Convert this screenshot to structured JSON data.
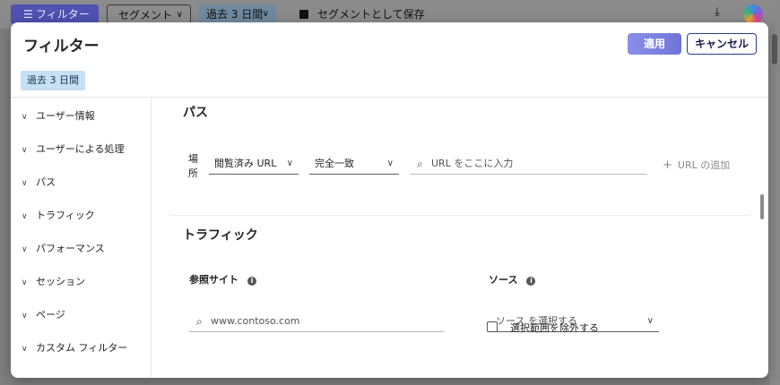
{
  "topbar": {
    "filter_label": "フィルター",
    "segment_label": "セグメント",
    "date_label": "過去 3 日間",
    "save_label": "セグメントとして保存"
  },
  "dialog": {
    "title": "フィルター",
    "apply_label": "適用",
    "cancel_label": "キャンセル",
    "date_chip": "過去 3 日間"
  },
  "sidebar": {
    "items": [
      {
        "label": "ユーザー情報"
      },
      {
        "label": "ユーザーによる処理"
      },
      {
        "label": "パス"
      },
      {
        "label": "トラフィック"
      },
      {
        "label": "パフォーマンス"
      },
      {
        "label": "セッション"
      },
      {
        "label": "ページ"
      },
      {
        "label": "カスタム フィルター"
      }
    ]
  },
  "path_section": {
    "title": "パス",
    "location_label": "場所",
    "page_dropdown": "閲覧済み URL",
    "match_dropdown": "完全一致",
    "url_placeholder": "URL をここに入力",
    "add_url_label": "URL の追加"
  },
  "traffic_section": {
    "title": "トラフィック",
    "referrer_label": "参照サイト",
    "referrer_placeholder": "www.contoso.com",
    "source_label": "ソース",
    "source_placeholder": "ソース を選択する",
    "exclude_label": "選択範囲を除外する"
  },
  "icons": {
    "filter": "filter-icon",
    "chevron": "chevron-down-icon",
    "save": "save-icon",
    "download": "download-icon",
    "copilot": "copilot-icon",
    "search": "search-icon",
    "info": "info-icon",
    "add": "add-icon"
  },
  "colors": {
    "primary": "#4f52b2",
    "apply_button": "#7b80e0",
    "date_chip_bg": "#c7e0f4"
  }
}
